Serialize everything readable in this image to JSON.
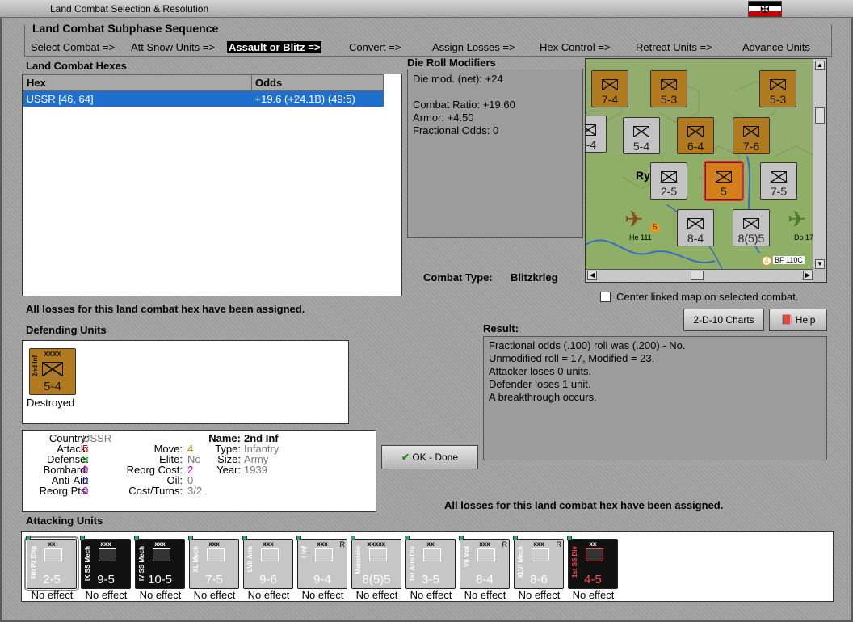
{
  "window": {
    "title": "Land Combat Selection & Resolution"
  },
  "subphase": {
    "title": "Land Combat Subphase Sequence",
    "steps": [
      "Select Combat =>",
      "Att Snow Units =>",
      "Assault or Blitz =>",
      "Convert =>",
      "Assign Losses =>",
      "Hex Control =>",
      "Retreat Units =>",
      "Advance Units"
    ],
    "active_index": 2
  },
  "hexes": {
    "label": "Land Combat Hexes",
    "columns": [
      "Hex",
      "Odds"
    ],
    "rows": [
      {
        "hex": "USSR [46, 64]",
        "odds": "+19.6 (+24.1B) (49:5)"
      }
    ]
  },
  "modifiers": {
    "label": "Die Roll Modifiers",
    "lines": [
      "Die mod. (net): +24",
      "",
      "Combat Ratio: +19.60",
      "Armor: +4.50",
      "Fractional Odds: 0"
    ]
  },
  "combat_type": {
    "label": "Combat Type:",
    "value": "Blitzkrieg"
  },
  "map": {
    "town_label": "Ry",
    "units": [
      {
        "val": "7-4",
        "color": "tan"
      },
      {
        "val": "5-3",
        "color": "tan"
      },
      {
        "val": "5-3",
        "color": "tan"
      },
      {
        "val": "5-4",
        "color": "gray"
      },
      {
        "val": "6-4",
        "color": "tan"
      },
      {
        "val": "7-6",
        "color": "tan"
      },
      {
        "val": "2-5",
        "color": "gray"
      },
      {
        "val": "5",
        "color": "orange"
      },
      {
        "val": "7-5",
        "color": "gray"
      },
      {
        "val": "8-4",
        "color": "gray"
      },
      {
        "val": "8(5)5",
        "color": "gray"
      }
    ],
    "air": [
      {
        "name": "He 111",
        "val": "5"
      },
      {
        "name": "Do 17",
        "val": ""
      }
    ],
    "corner_label": "BF 110C",
    "corner_num": "4"
  },
  "center_map": {
    "label": "Center linked map on selected combat.",
    "checked": false
  },
  "buttons": {
    "charts": "2-D-10 Charts",
    "help": "Help",
    "ok": "OK - Done"
  },
  "losses_msg_top": "All losses for this land combat hex have been assigned.",
  "losses_msg_bottom": "All losses for this land combat hex have been assigned.",
  "defending": {
    "label": "Defending Units",
    "unit": {
      "name_short": "2nd Inf",
      "size": "XXXX",
      "val": "5-4",
      "status": "Destroyed"
    }
  },
  "stats": {
    "country_label": "Country:",
    "country": "USSR",
    "attack_label": "Attack:",
    "attack": "5",
    "defense_label": "Defense:",
    "defense": "5",
    "bombard_label": "Bombard:",
    "bombard": "0",
    "antiair_label": "Anti-Air:",
    "antiair": "0",
    "reorgpts_label": "Reorg Pts:",
    "reorgpts": "0",
    "move_label": "Move:",
    "move": "4",
    "elite_label": "Elite:",
    "elite": "No",
    "reorgcost_label": "Reorg Cost:",
    "reorgcost": "2",
    "oil_label": "Oil:",
    "oil": "0",
    "costturns_label": "Cost/Turns:",
    "costturns": "3/2",
    "name_label": "Name:",
    "name": "2nd Inf",
    "type_label": "Type:",
    "type": "Infantry",
    "size_label": "Size:",
    "size": "Army",
    "year_label": "Year:",
    "year": "1939"
  },
  "result": {
    "label": "Result:",
    "lines": [
      "Fractional odds (.100) roll was (.200)  - No.",
      "Unmodified roll = 17, Modified = 23.",
      "Attacker loses 0 units.",
      "Defender loses 1 unit.",
      "A breakthrough occurs."
    ]
  },
  "attacking": {
    "label": "Attacking Units",
    "units": [
      {
        "name": "6th Pz Eng",
        "size": "xx",
        "val": "2-5",
        "style": "lgray",
        "effect": "No effect",
        "r": ""
      },
      {
        "name": "IX SS Mech",
        "size": "xxx",
        "val": "9-5",
        "style": "black",
        "effect": "No effect",
        "r": ""
      },
      {
        "name": "IV SS Mech",
        "size": "xxx",
        "val": "10-5",
        "style": "black",
        "effect": "No effect",
        "r": ""
      },
      {
        "name": "XL Mech",
        "size": "xxx",
        "val": "7-5",
        "style": "lgray",
        "effect": "No effect",
        "r": ""
      },
      {
        "name": "LVII Arm",
        "size": "xxx",
        "val": "9-6",
        "style": "lgray",
        "effect": "No effect",
        "r": ""
      },
      {
        "name": "I Inf",
        "size": "xxx",
        "val": "9-4",
        "style": "lgray",
        "effect": "No effect",
        "r": "R"
      },
      {
        "name": "Manstein",
        "size": "xxxxx",
        "val": "8(5)5",
        "style": "lgray",
        "effect": "No effect",
        "r": ""
      },
      {
        "name": "1st Arm Div",
        "size": "xx",
        "val": "3-5",
        "style": "lgray",
        "effect": "No effect",
        "r": ""
      },
      {
        "name": "VII Mot",
        "size": "xxx",
        "val": "8-4",
        "style": "lgray",
        "effect": "No effect",
        "r": "R"
      },
      {
        "name": "XLVI Mech",
        "size": "xxx",
        "val": "8-6",
        "style": "lgray",
        "effect": "No effect",
        "r": "R"
      },
      {
        "name": "1st SS Div",
        "size": "xx",
        "val": "4-5",
        "style": "red",
        "effect": "No effect",
        "r": ""
      }
    ]
  }
}
